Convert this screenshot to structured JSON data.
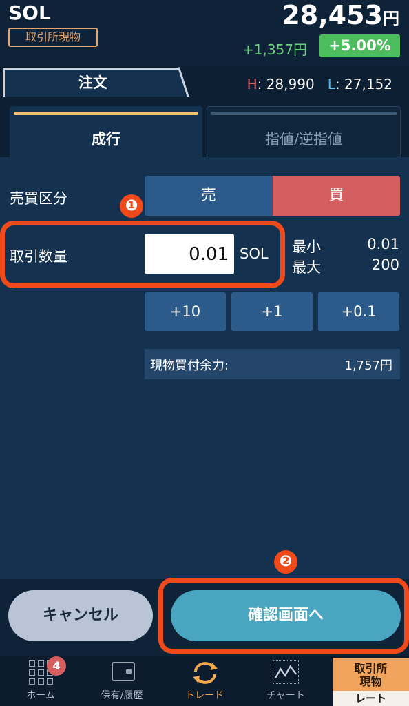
{
  "header": {
    "symbol": "SOL",
    "market_badge": "取引所現物",
    "price": "28,453",
    "price_unit": "円",
    "change_value": "+1,357円",
    "change_pct": "+5.00%"
  },
  "order_bar": {
    "tab_label": "注文",
    "high_letter": "H",
    "high_value": ": 28,990",
    "low_letter": "L",
    "low_value": ": 27,152"
  },
  "sub_tabs": {
    "market": "成行",
    "limit": "指値/逆指値",
    "active": "market"
  },
  "form": {
    "side_label": "売買区分",
    "sell_label": "売",
    "buy_label": "買",
    "selected_side": "buy",
    "qty_label": "取引数量",
    "qty_value": "0.01",
    "qty_unit": "SOL",
    "min_label": "最小",
    "min_value": "0.01",
    "max_label": "最大",
    "max_value": "200",
    "steps": [
      "+10",
      "+1",
      "+0.1"
    ],
    "buying_power_label": "現物買付余力:",
    "buying_power_value": "1,757円"
  },
  "actions": {
    "cancel_label": "キャンセル",
    "confirm_label": "確認画面へ"
  },
  "annotations": {
    "callout_1": "❶",
    "callout_2": "❷",
    "accent_color": "#f04a1a"
  },
  "bottom_nav": {
    "home_label": "ホーム",
    "home_badge": "4",
    "holdings_label": "保有/履歴",
    "trade_label": "トレード",
    "chart_label": "チャート",
    "rate_top": "取引所\n現物",
    "rate_top_line1": "取引所",
    "rate_top_line2": "現物",
    "rate_bottom": "レート",
    "active": "trade"
  },
  "colors": {
    "buy": "#d55f5f",
    "sell": "#2c5a8a",
    "positive": "#4cbc5d",
    "confirm": "#4aa6c0",
    "accent_orange": "#f0a94e"
  }
}
